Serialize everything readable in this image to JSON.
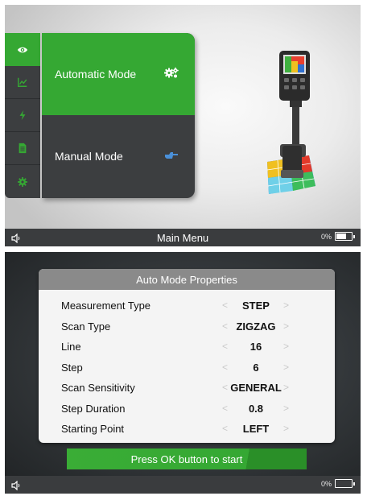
{
  "main_menu": {
    "side_tabs": [
      {
        "icon": "eye-icon",
        "active": true
      },
      {
        "icon": "chart-icon",
        "active": false
      },
      {
        "icon": "lightning-icon",
        "active": false
      },
      {
        "icon": "document-icon",
        "active": false
      },
      {
        "icon": "gear-icon",
        "active": false
      }
    ],
    "items": [
      {
        "label": "Automatic Mode",
        "icon": "gears-icon",
        "selected": true
      },
      {
        "label": "Manual Mode",
        "icon": "hand-pointer-icon",
        "selected": false
      }
    ],
    "status": {
      "title": "Main Menu",
      "battery_percent": "0%",
      "battery_level": 0.6
    }
  },
  "auto_mode": {
    "title": "Auto Mode Properties",
    "properties": [
      {
        "label": "Measurement Type",
        "value": "STEP"
      },
      {
        "label": "Scan Type",
        "value": "ZIGZAG"
      },
      {
        "label": "Line",
        "value": "16"
      },
      {
        "label": "Step",
        "value": "6"
      },
      {
        "label": "Scan Sensitivity",
        "value": "GENERAL"
      },
      {
        "label": "Step Duration",
        "value": "0.8"
      },
      {
        "label": "Starting Point",
        "value": "LEFT"
      }
    ],
    "start_button": "Press OK button to start",
    "status": {
      "title": "",
      "battery_percent": "0%",
      "battery_level": 0.0
    }
  },
  "arrows": {
    "left": "<",
    "right": ">"
  },
  "colors": {
    "accent": "#35a833",
    "panel_dark": "#3c3e40",
    "status_bar": "#3a3c3e",
    "header_gray": "#8a8a8a"
  }
}
